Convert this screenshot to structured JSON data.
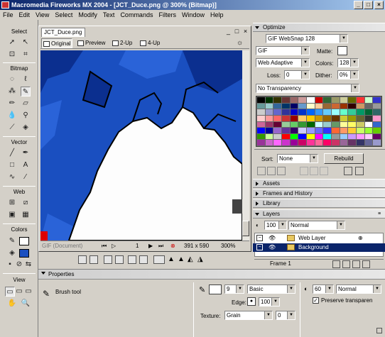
{
  "window": {
    "title": "Macromedia Fireworks MX 2004 - [JCT_Duce.png @ 300% (Bitmap)]",
    "min": "_",
    "max": "□",
    "close": "×",
    "doc_min": "_",
    "doc_max": "□",
    "doc_close": "×"
  },
  "menu": [
    "File",
    "Edit",
    "View",
    "Select",
    "Modify",
    "Text",
    "Commands",
    "Filters",
    "Window",
    "Help"
  ],
  "tools": {
    "select": "Select",
    "bitmap": "Bitmap",
    "vector": "Vector",
    "web": "Web",
    "colors": "Colors",
    "view": "View"
  },
  "document": {
    "tab": "JCT_Duce.png",
    "views": [
      "Original",
      "Preview",
      "2-Up",
      "4-Up"
    ],
    "status": {
      "format": "GIF (Document)",
      "frame": "1",
      "dimensions": "391 x 590",
      "zoom": "300%"
    }
  },
  "panels": {
    "optimize": {
      "title": "Optimize",
      "preset": "GIF WebSnap 128",
      "format": "GIF",
      "matte_label": "Matte:",
      "palette": "Web Adaptive",
      "colors_label": "Colors:",
      "colors": "128",
      "loss_label": "Loss:",
      "loss": "0",
      "dither_label": "Dither:",
      "dither": "0%",
      "transparency": "No Transparency",
      "sort_label": "Sort:",
      "sort": "None",
      "rebuild": "Rebuild"
    },
    "collapsed": [
      "Assets",
      "Frames and History",
      "Library"
    ],
    "layers": {
      "title": "Layers",
      "opacity": "100",
      "blend": "Normal",
      "rows": [
        {
          "name": "Web Layer"
        },
        {
          "name": "Background"
        }
      ],
      "frame": "Frame 1"
    }
  },
  "palette_colors": [
    "#000000",
    "#003300",
    "#333300",
    "#663333",
    "#996666",
    "#cc9999",
    "#ffffff",
    "#cc0000",
    "#336633",
    "#999966",
    "#cccc99",
    "#666600",
    "#ff3333",
    "#ccffcc",
    "#3333cc",
    "#669999",
    "#99cccc",
    "#336699",
    "#003366",
    "#000066",
    "#6699cc",
    "#ffffcc",
    "#ffcc99",
    "#996633",
    "#cc6633",
    "#993300",
    "#330000",
    "#cc9966",
    "#666666",
    "#999999",
    "#cccccc",
    "#9999cc",
    "#6666cc",
    "#333399",
    "#0000cc",
    "#0033cc",
    "#0066ff",
    "#3399ff",
    "#66ccff",
    "#99ffff",
    "#66ffcc",
    "#33cc99",
    "#009966",
    "#006633",
    "#336666",
    "#ffcccc",
    "#ff9999",
    "#ff6666",
    "#cc3333",
    "#990000",
    "#ffcc66",
    "#ffcc00",
    "#cc9900",
    "#996600",
    "#663300",
    "#cccc33",
    "#999900",
    "#666633",
    "#333333",
    "#ff99cc",
    "#cc6699",
    "#993366",
    "#660033",
    "#99cc99",
    "#66cc66",
    "#339933",
    "#006600",
    "#ccffff",
    "#99cccc",
    "#669966",
    "#ffff99",
    "#ffff66",
    "#cccc66",
    "#ffffff",
    "#3366cc",
    "#0000ff",
    "#000099",
    "#9966cc",
    "#663399",
    "#330066",
    "#ccccff",
    "#9999ff",
    "#6666ff",
    "#3333ff",
    "#ff6633",
    "#ff9966",
    "#ffcc33",
    "#ccff66",
    "#99ff33",
    "#66cc00",
    "#339900",
    "#ccff99",
    "#cccccc",
    "#ff0000",
    "#00ff00",
    "#0000ff",
    "#ffff00",
    "#ff00ff",
    "#00ffff",
    "#999999",
    "#99ccff",
    "#cc99ff",
    "#ff99ff",
    "#ffccff",
    "#660066",
    "#993399",
    "#cc66cc",
    "#ff66ff",
    "#cc33cc",
    "#990099",
    "#cc0066",
    "#ff3399",
    "#ff6699",
    "#ff0066",
    "#cc3366",
    "#996699",
    "#663366",
    "#333366",
    "#666699",
    "#9999cc",
    "#ccccee",
    "#e0e0e0",
    "#b0b0b0"
  ],
  "properties": {
    "title": "Properties",
    "tool": "Brush tool",
    "size": "9",
    "stroke": "Basic",
    "edge_label": "Edge:",
    "edge": "100",
    "texture_label": "Texture:",
    "texture": "Grain",
    "texture_amount": "0",
    "opacity": "60",
    "blend": "Normal",
    "preserve": "Preserve transparen"
  }
}
